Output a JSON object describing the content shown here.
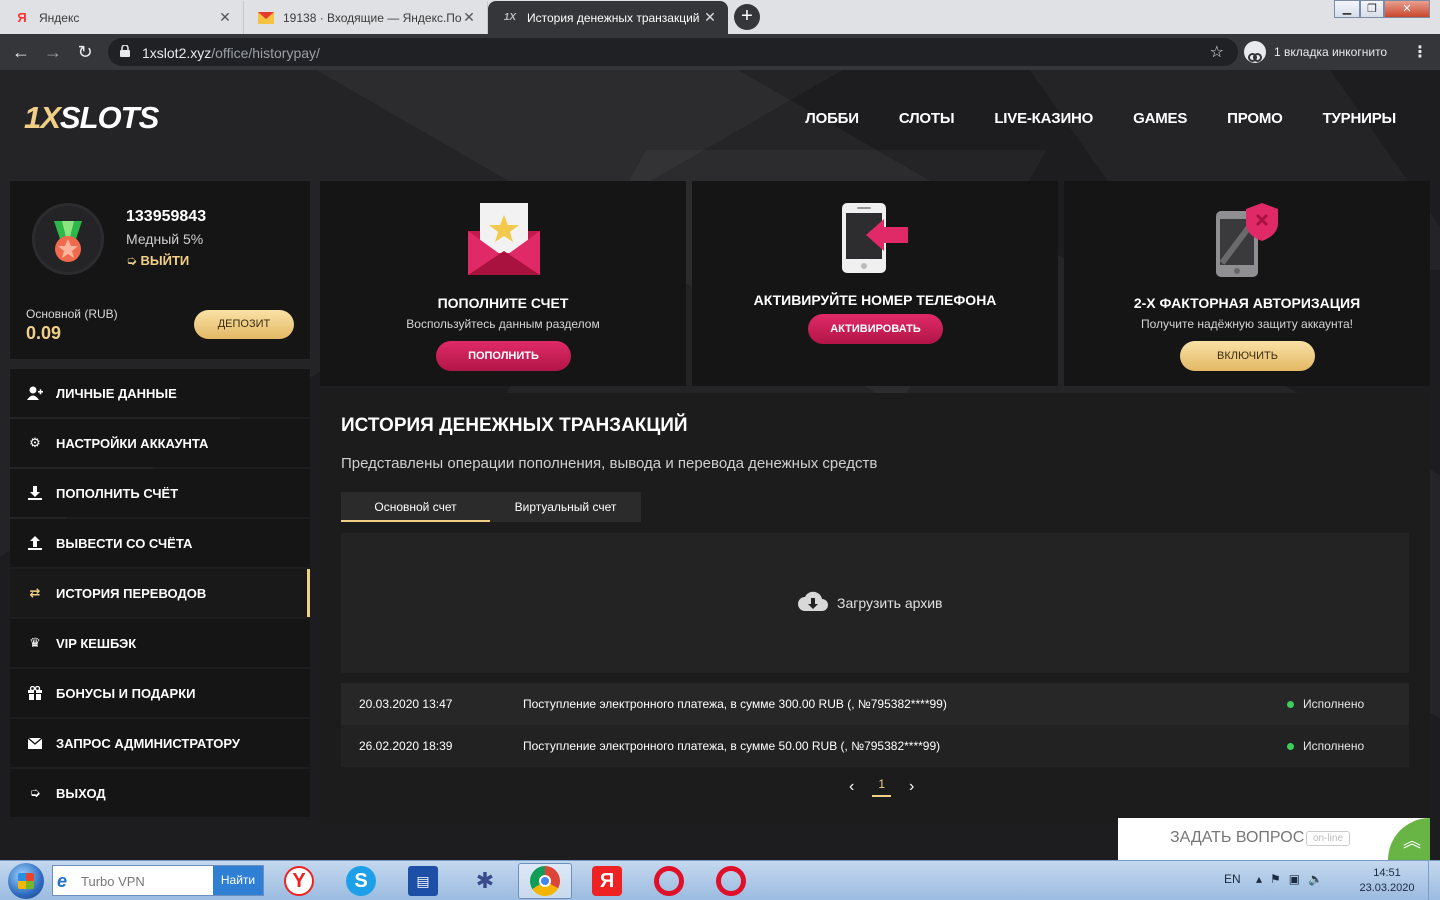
{
  "browser": {
    "tabs": [
      {
        "label": "Яндекс",
        "favicon": "Я",
        "active": false
      },
      {
        "label": "19138 · Входящие — Яндекс.По",
        "favicon": "mail-icon",
        "active": false
      },
      {
        "label": "История денежных транзакций",
        "favicon": "1X",
        "active": true
      }
    ],
    "url_host": "1xslot2.xyz",
    "url_path": "/office/historypay/",
    "incognito_label": "1 вкладка инкогнито"
  },
  "site": {
    "logo_part1": "1X",
    "logo_part2": "SLOTS",
    "nav": [
      "ЛОББИ",
      "СЛОТЫ",
      "LIVE-КАЗИНО",
      "GAMES",
      "ПРОМО",
      "ТУРНИРЫ"
    ]
  },
  "profile": {
    "user_id": "133959843",
    "level": "Медный 5%",
    "logout": "ВЫЙТИ",
    "balance_label": "Основной (RUB)",
    "balance_value": "0.09",
    "deposit_button": "ДЕПОЗИТ"
  },
  "menu": [
    {
      "label": "ЛИЧНЫЕ ДАННЫЕ",
      "icon": "user-plus-icon"
    },
    {
      "label": "НАСТРОЙКИ АККАУНТА",
      "icon": "gears-icon"
    },
    {
      "label": "ПОПОЛНИТЬ СЧЁТ",
      "icon": "download-icon"
    },
    {
      "label": "ВЫВЕСТИ СО СЧЁТА",
      "icon": "upload-icon"
    },
    {
      "label": "ИСТОРИЯ ПЕРЕВОДОВ",
      "icon": "transfer-icon",
      "active": true
    },
    {
      "label": "VIP КЕШБЭК",
      "icon": "crown-icon"
    },
    {
      "label": "БОНУСЫ И ПОДАРКИ",
      "icon": "gift-icon"
    },
    {
      "label": "ЗАПРОС АДМИНИСТРАТОРУ",
      "icon": "envelope-icon"
    },
    {
      "label": "ВЫХОД",
      "icon": "exit-icon"
    }
  ],
  "cards": [
    {
      "title": "ПОПОЛНИТЕ СЧЕТ",
      "subtitle": "Воспользуйтесь данным разделом",
      "button": "ПОПОЛНИТЬ"
    },
    {
      "title": "АКТИВИРУЙТЕ НОМЕР ТЕЛЕФОНА",
      "subtitle": "",
      "button": "АКТИВИРОВАТЬ"
    },
    {
      "title": "2-Х ФАКТОРНАЯ АВТОРИЗАЦИЯ",
      "subtitle": "Получите надёжную защиту аккаунта!",
      "button": "ВКЛЮЧИТЬ"
    }
  ],
  "history": {
    "title": "ИСТОРИЯ ДЕНЕЖНЫХ ТРАНЗАКЦИЙ",
    "subtitle": "Представлены операции пополнения, вывода и перевода денежных средств",
    "tabs": [
      "Основной счет",
      "Виртуальный счет"
    ],
    "archive_label": "Загрузить архив",
    "rows": [
      {
        "date": "20.03.2020 13:47",
        "text": "Поступление электронного платежа, в сумме 300.00 RUB (, №795382****99)",
        "status": "Исполнено"
      },
      {
        "date": "26.02.2020 18:39",
        "text": "Поступление электронного платежа, в сумме 50.00 RUB (, №795382****99)",
        "status": "Исполнено"
      }
    ],
    "pager": {
      "prev": "‹",
      "current": "1",
      "next": "›"
    }
  },
  "chat": {
    "label": "ЗАДАТЬ ВОПРОС",
    "status": "on-line"
  },
  "taskbar": {
    "search_text": "Turbo VPN",
    "search_button": "Найти",
    "lang": "EN",
    "time": "14:51",
    "date": "23.03.2020"
  },
  "colors": {
    "accent_gold": "#f2cf86",
    "accent_pink": "#d81f5e",
    "status_ok": "#3bcf5a"
  }
}
